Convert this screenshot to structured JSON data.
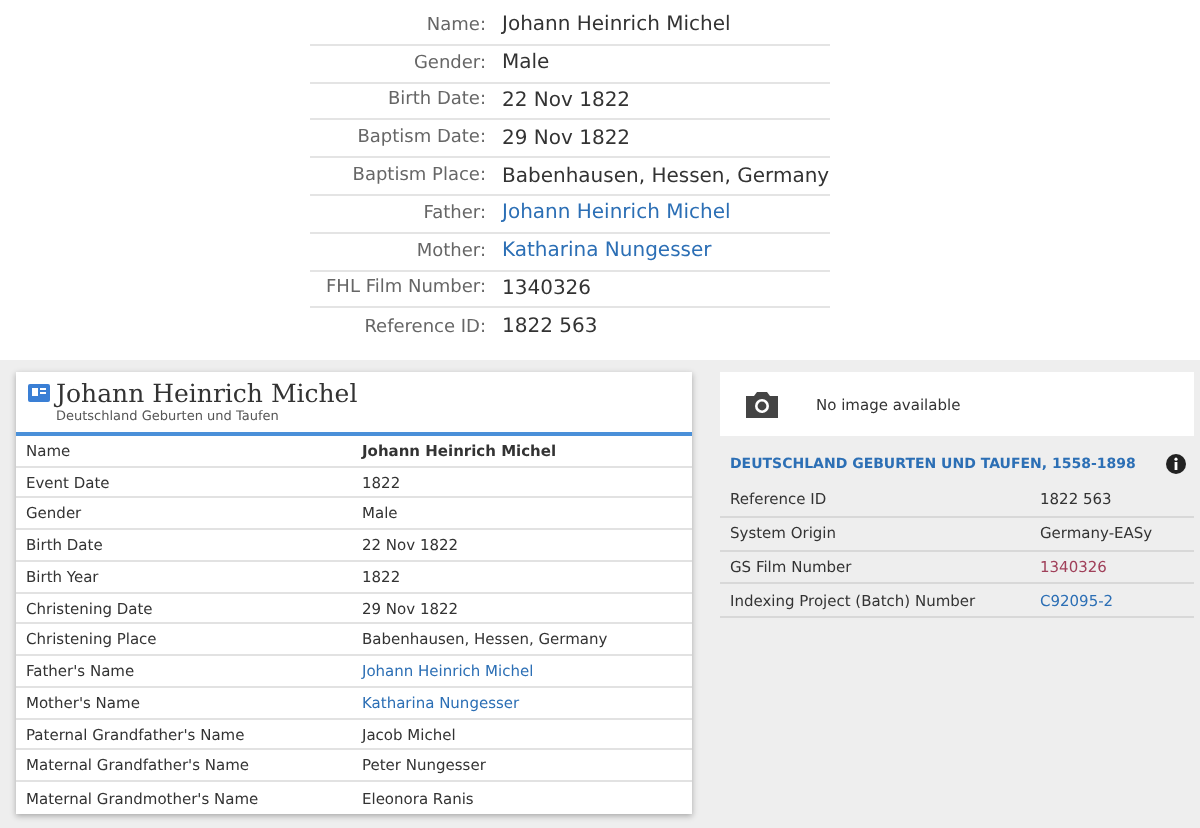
{
  "summary": [
    {
      "label": "Name:",
      "value": "Johann Heinrich Michel",
      "kind": "text"
    },
    {
      "label": "Gender:",
      "value": "Male",
      "kind": "text"
    },
    {
      "label": "Birth Date:",
      "value": "22 Nov 1822",
      "kind": "text"
    },
    {
      "label": "Baptism Date:",
      "value": "29 Nov 1822",
      "kind": "text"
    },
    {
      "label": "Baptism Place:",
      "value": "Babenhausen, Hessen, Germany",
      "kind": "text"
    },
    {
      "label": "Father:",
      "value": "Johann Heinrich Michel",
      "kind": "link"
    },
    {
      "label": "Mother:",
      "value": "Katharina Nungesser",
      "kind": "link"
    },
    {
      "label": "FHL Film Number:",
      "value": "1340326",
      "kind": "text"
    },
    {
      "label": "Reference ID:",
      "value": "1822 563",
      "kind": "text"
    }
  ],
  "record": {
    "title": "Johann Heinrich Michel",
    "subtitle": "Deutschland Geburten und Taufen",
    "rows": [
      {
        "label": "Name",
        "value": "Johann Heinrich Michel",
        "kind": "bold"
      },
      {
        "label": "Event Date",
        "value": "1822",
        "kind": "text"
      },
      {
        "label": "Gender",
        "value": "Male",
        "kind": "text"
      },
      {
        "label": "Birth Date",
        "value": "22 Nov 1822",
        "kind": "text"
      },
      {
        "label": "Birth Year",
        "value": "1822",
        "kind": "text"
      },
      {
        "label": "Christening Date",
        "value": "29 Nov 1822",
        "kind": "text"
      },
      {
        "label": "Christening Place",
        "value": "Babenhausen, Hessen, Germany",
        "kind": "text"
      },
      {
        "label": "Father's Name",
        "value": "Johann Heinrich Michel",
        "kind": "link"
      },
      {
        "label": "Mother's Name",
        "value": "Katharina Nungesser",
        "kind": "link"
      },
      {
        "label": "Paternal Grandfather's Name",
        "value": "Jacob Michel",
        "kind": "text"
      },
      {
        "label": "Maternal Grandfather's Name",
        "value": "Peter Nungesser",
        "kind": "text"
      },
      {
        "label": "Maternal Grandmother's Name",
        "value": "Eleonora Ranis",
        "kind": "text"
      }
    ]
  },
  "image_panel": {
    "text": "No image available"
  },
  "collection": {
    "title": "DEUTSCHLAND GEBURTEN UND TAUFEN, 1558-1898",
    "rows": [
      {
        "label": "Reference ID",
        "value": "1822 563",
        "kind": "text"
      },
      {
        "label": "System Origin",
        "value": "Germany-EASy",
        "kind": "text"
      },
      {
        "label": "GS Film Number",
        "value": "1340326",
        "kind": "visited"
      },
      {
        "label": "Indexing Project (Batch) Number",
        "value": "C92095-2",
        "kind": "link"
      }
    ]
  }
}
